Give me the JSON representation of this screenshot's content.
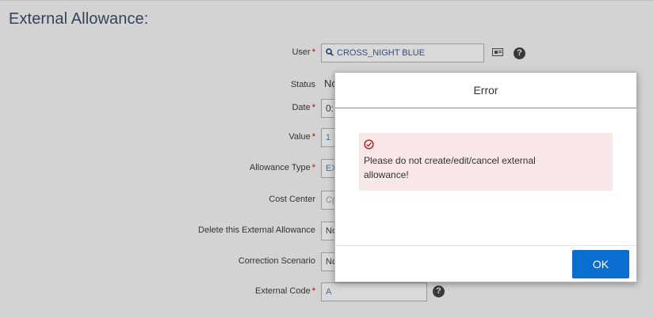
{
  "page": {
    "title": "External Allowance:"
  },
  "form": {
    "required_marker": "*",
    "user": {
      "label": "User",
      "value": "CROSS_NIGHT BLUE"
    },
    "status": {
      "label": "Status",
      "value": "No"
    },
    "date": {
      "label": "Date",
      "value": "0:"
    },
    "value": {
      "label": "Value",
      "value": "1"
    },
    "allowance_type": {
      "label": "Allowance Type",
      "value": "EX"
    },
    "cost_center": {
      "label": "Cost Center",
      "placeholder": "C("
    },
    "delete": {
      "label": "Delete this External Allowance",
      "value": "No"
    },
    "correction": {
      "label": "Correction Scenario",
      "value": "No"
    },
    "external_code": {
      "label": "External Code",
      "value": "A"
    },
    "help_glyph": "?"
  },
  "dialog": {
    "title": "Error",
    "message": "Please do not create/edit/cancel external allowance!",
    "ok_label": "OK"
  },
  "icons": {
    "search": "magnifier-icon",
    "card": "id-card-icon",
    "help": "question-circle-icon",
    "error": "error-circle-icon"
  },
  "colors": {
    "primary_button": "#0a6ed1",
    "error_background": "#f9e6e6",
    "error_icon": "#bb0000",
    "required": "#b00000"
  }
}
